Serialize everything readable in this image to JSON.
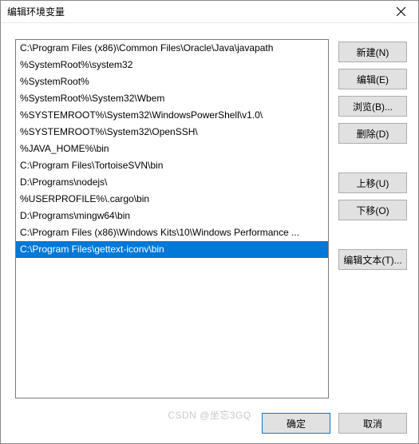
{
  "title": "编辑环境变量",
  "list_items": [
    {
      "text": "C:\\Program Files (x86)\\Common Files\\Oracle\\Java\\javapath",
      "selected": false
    },
    {
      "text": "%SystemRoot%\\system32",
      "selected": false
    },
    {
      "text": "%SystemRoot%",
      "selected": false
    },
    {
      "text": "%SystemRoot%\\System32\\Wbem",
      "selected": false
    },
    {
      "text": "%SYSTEMROOT%\\System32\\WindowsPowerShell\\v1.0\\",
      "selected": false
    },
    {
      "text": "%SYSTEMROOT%\\System32\\OpenSSH\\",
      "selected": false
    },
    {
      "text": "%JAVA_HOME%\\bin",
      "selected": false
    },
    {
      "text": "C:\\Program Files\\TortoiseSVN\\bin",
      "selected": false
    },
    {
      "text": "D:\\Programs\\nodejs\\",
      "selected": false
    },
    {
      "text": "%USERPROFILE%\\.cargo\\bin",
      "selected": false
    },
    {
      "text": "D:\\Programs\\mingw64\\bin",
      "selected": false
    },
    {
      "text": "C:\\Program Files (x86)\\Windows Kits\\10\\Windows Performance ...",
      "selected": false
    },
    {
      "text": "C:\\Program Files\\gettext-iconv\\bin",
      "selected": true
    }
  ],
  "buttons": {
    "new": "新建(N)",
    "edit": "编辑(E)",
    "browse": "浏览(B)...",
    "delete": "删除(D)",
    "move_up": "上移(U)",
    "move_down": "下移(O)",
    "edit_text": "编辑文本(T)...",
    "ok": "确定",
    "cancel": "取消"
  },
  "watermark": "CSDN @坐忘3GQ"
}
